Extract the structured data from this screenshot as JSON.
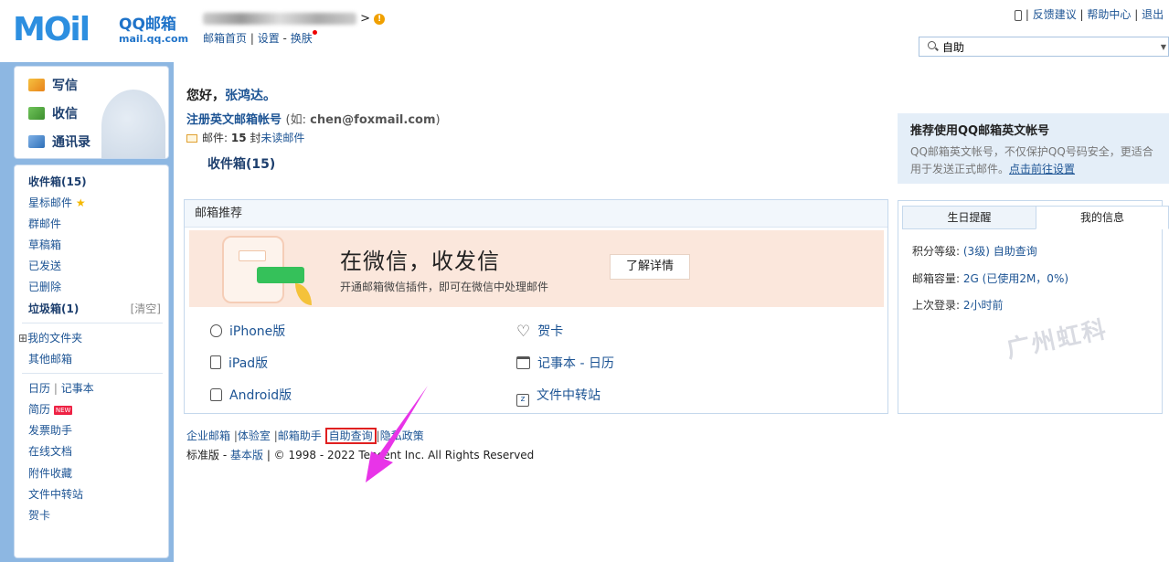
{
  "header": {
    "logo_mark": "MOil",
    "logo_title": "QQ邮箱",
    "logo_domain": "mail.qq.com",
    "account_suffix": ">",
    "links": [
      "邮箱首页",
      "设置",
      "换肤"
    ],
    "top_links": [
      "反馈建议",
      "帮助中心",
      "退出"
    ],
    "search_value": "自助"
  },
  "sidebar": {
    "compose": "写信",
    "receive": "收信",
    "contacts": "通讯录",
    "folders": {
      "inbox": "收件箱(15)",
      "starred": "星标邮件",
      "group": "群邮件",
      "drafts": "草稿箱",
      "sent": "已发送",
      "deleted": "已删除",
      "spam": "垃圾箱(1)",
      "spam_clear": "[清空]",
      "my_folders": "我的文件夹",
      "other_mail": "其他邮箱"
    },
    "tools": {
      "calendar": "日历",
      "notes": "记事本",
      "resume": "简历",
      "new_badge": "NEW",
      "invoice": "发票助手",
      "docs": "在线文档",
      "attachments": "附件收藏",
      "transfer": "文件中转站",
      "cards": "贺卡"
    }
  },
  "main": {
    "greeting": "您好，",
    "user_name": "张鸿达。",
    "register_link": "注册英文邮箱帐号",
    "register_example_prefix": "(如:",
    "register_example": "chen@foxmail.com",
    "register_example_suffix": ")",
    "mail_label": "邮件:",
    "mail_count": "15",
    "mail_unit": "封",
    "unread_link": "未读邮件",
    "inbox_link": "收件箱(15)",
    "recommend_title": "邮箱推荐",
    "banner_title": "在微信，收发信",
    "banner_sub": "开通邮箱微信插件，即可在微信中处理邮件",
    "banner_button": "了解详情",
    "apps": {
      "iphone": "iPhone版",
      "ipad": "iPad版",
      "android": "Android版",
      "card": "贺卡",
      "notes_calendar": "记事本 - 日历",
      "transfer": "文件中转站"
    },
    "footer_links": [
      "企业邮箱",
      "体验室",
      "邮箱助手",
      "自助查询",
      "隐私政策"
    ],
    "footer_std": "标准版",
    "footer_basic": "基本版",
    "copyright": "© 1998 - 2022 Tencent Inc. All Rights Reserved"
  },
  "right": {
    "promo_title": "推荐使用QQ邮箱英文帐号",
    "promo_desc": "QQ邮箱英文帐号，不仅保护QQ号码安全，更适合用于发送正式邮件。",
    "promo_link": "点击前往设置",
    "tab_birthday": "生日提醒",
    "tab_info": "我的信息",
    "points_label": "积分等级:",
    "points_value": "(3级)",
    "points_link": "自助查询",
    "capacity_label": "邮箱容量:",
    "capacity_value": "2G",
    "capacity_used": "(已使用2M，0%)",
    "last_login_label": "上次登录:",
    "last_login_value": "2小时前",
    "watermark": "广州虹科"
  },
  "colors": {
    "accent_blue": "#1d5494",
    "frame_blue": "#8db7e2",
    "banner_bg": "#fbe7dc",
    "highlight_red": "#e02020",
    "arrow_magenta": "#e834e8"
  }
}
